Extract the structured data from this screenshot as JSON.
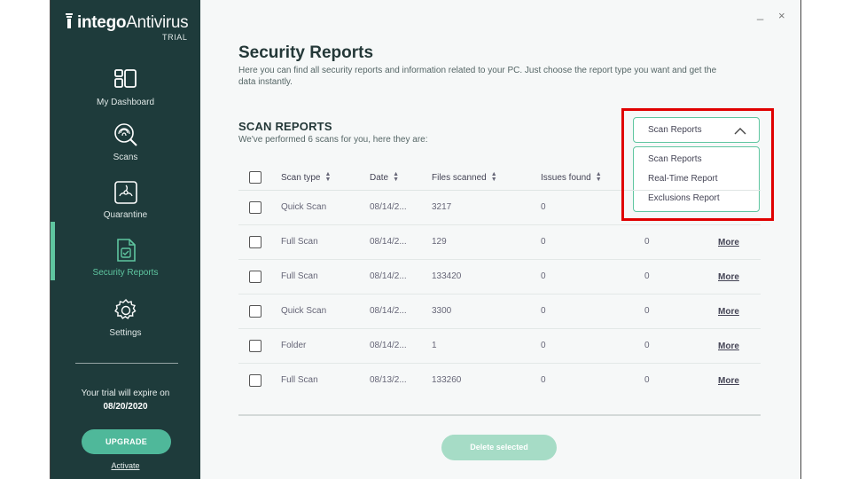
{
  "brand": {
    "name": "intego",
    "product": "Antivirus",
    "edition": "TRIAL"
  },
  "sidebar": {
    "items": [
      {
        "label": "My Dashboard",
        "icon": "dashboard-icon"
      },
      {
        "label": "Scans",
        "icon": "fingerprint-scan-icon"
      },
      {
        "label": "Quarantine",
        "icon": "biohazard-icon"
      },
      {
        "label": "Security Reports",
        "icon": "report-document-icon"
      },
      {
        "label": "Settings",
        "icon": "gear-icon"
      }
    ],
    "active_index": 3,
    "trial_text": "Your trial will expire on",
    "trial_date": "08/20/2020",
    "upgrade_label": "UPGRADE",
    "activate_label": "Activate"
  },
  "window": {
    "minimize": "_",
    "close": "×"
  },
  "header": {
    "title": "Security Reports",
    "description": "Here you can find all security reports and information related to your PC. Just choose the report type you want and get the data instantly."
  },
  "section": {
    "title": "SCAN REPORTS",
    "subtitle": "We've performed 6 scans for you, here they are:"
  },
  "report_select": {
    "value": "Scan Reports",
    "options": [
      "Scan Reports",
      "Real-Time Report",
      "Exclusions Report"
    ]
  },
  "table": {
    "columns": [
      "Scan type",
      "Date",
      "Files scanned",
      "Issues found"
    ],
    "more_label": "More",
    "rows": [
      {
        "type": "Quick Scan",
        "date": "08/14/2...",
        "files": "3217",
        "issues": "0",
        "extra": ""
      },
      {
        "type": "Full Scan",
        "date": "08/14/2...",
        "files": "129",
        "issues": "0",
        "extra": "0"
      },
      {
        "type": "Full Scan",
        "date": "08/14/2...",
        "files": "133420",
        "issues": "0",
        "extra": "0"
      },
      {
        "type": "Quick Scan",
        "date": "08/14/2...",
        "files": "3300",
        "issues": "0",
        "extra": "0"
      },
      {
        "type": "Folder",
        "date": "08/14/2...",
        "files": "1",
        "issues": "0",
        "extra": "0"
      },
      {
        "type": "Full Scan",
        "date": "08/13/2...",
        "files": "133260",
        "issues": "0",
        "extra": "0"
      }
    ]
  },
  "actions": {
    "delete_label": "Delete selected"
  },
  "colors": {
    "sidebar": "#1e3b3b",
    "accent": "#5fc6a0",
    "highlight": "#e00000"
  }
}
